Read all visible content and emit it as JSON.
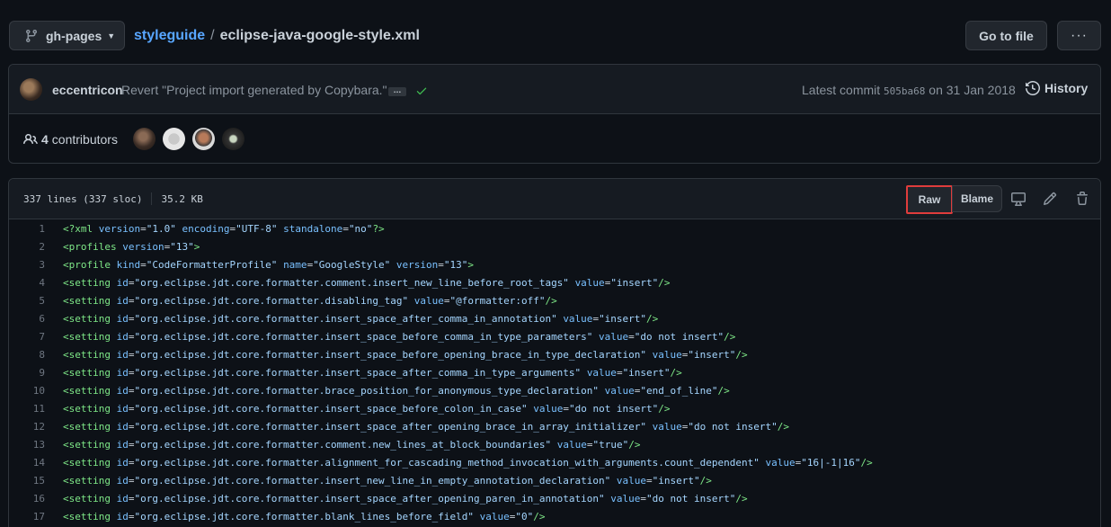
{
  "branch": {
    "label": "gh-pages"
  },
  "breadcrumb": {
    "repo": "styleguide",
    "separator": "/",
    "file": "eclipse-java-google-style.xml"
  },
  "header_buttons": {
    "go_to_file": "Go to file",
    "more": "···"
  },
  "commit": {
    "author": "eccentricon",
    "message": "Revert \"Project import generated by Copybara.\"",
    "ellipsis": "…",
    "latest_prefix": "Latest commit",
    "sha": "505ba68",
    "date_prefix": "on",
    "date": "31 Jan 2018",
    "history_label": "History",
    "status_color": "#3fb950"
  },
  "contributors": {
    "count": "4",
    "label": "contributors"
  },
  "file": {
    "lines_info": "337 lines (337 sloc)",
    "size": "35.2 KB",
    "raw_label": "Raw",
    "blame_label": "Blame"
  },
  "code_lines": [
    {
      "n": "1",
      "parts": [
        [
          "tag",
          "<?xml"
        ],
        [
          "punc",
          " "
        ],
        [
          "attr",
          "version"
        ],
        [
          "punc",
          "="
        ],
        [
          "str",
          "\"1.0\""
        ],
        [
          "punc",
          " "
        ],
        [
          "attr",
          "encoding"
        ],
        [
          "punc",
          "="
        ],
        [
          "str",
          "\"UTF-8\""
        ],
        [
          "punc",
          " "
        ],
        [
          "attr",
          "standalone"
        ],
        [
          "punc",
          "="
        ],
        [
          "str",
          "\"no\""
        ],
        [
          "tag",
          "?>"
        ]
      ]
    },
    {
      "n": "2",
      "parts": [
        [
          "tag",
          "<profiles"
        ],
        [
          "punc",
          " "
        ],
        [
          "attr",
          "version"
        ],
        [
          "punc",
          "="
        ],
        [
          "str",
          "\"13\""
        ],
        [
          "tag",
          ">"
        ]
      ]
    },
    {
      "n": "3",
      "parts": [
        [
          "tag",
          "<profile"
        ],
        [
          "punc",
          " "
        ],
        [
          "attr",
          "kind"
        ],
        [
          "punc",
          "="
        ],
        [
          "str",
          "\"CodeFormatterProfile\""
        ],
        [
          "punc",
          " "
        ],
        [
          "attr",
          "name"
        ],
        [
          "punc",
          "="
        ],
        [
          "str",
          "\"GoogleStyle\""
        ],
        [
          "punc",
          " "
        ],
        [
          "attr",
          "version"
        ],
        [
          "punc",
          "="
        ],
        [
          "str",
          "\"13\""
        ],
        [
          "tag",
          ">"
        ]
      ]
    },
    {
      "n": "4",
      "parts": [
        [
          "tag",
          "<setting"
        ],
        [
          "punc",
          " "
        ],
        [
          "attr",
          "id"
        ],
        [
          "punc",
          "="
        ],
        [
          "str",
          "\"org.eclipse.jdt.core.formatter.comment.insert_new_line_before_root_tags\""
        ],
        [
          "punc",
          " "
        ],
        [
          "attr",
          "value"
        ],
        [
          "punc",
          "="
        ],
        [
          "str",
          "\"insert\""
        ],
        [
          "tag",
          "/>"
        ]
      ]
    },
    {
      "n": "5",
      "parts": [
        [
          "tag",
          "<setting"
        ],
        [
          "punc",
          " "
        ],
        [
          "attr",
          "id"
        ],
        [
          "punc",
          "="
        ],
        [
          "str",
          "\"org.eclipse.jdt.core.formatter.disabling_tag\""
        ],
        [
          "punc",
          " "
        ],
        [
          "attr",
          "value"
        ],
        [
          "punc",
          "="
        ],
        [
          "str",
          "\"@formatter:off\""
        ],
        [
          "tag",
          "/>"
        ]
      ]
    },
    {
      "n": "6",
      "parts": [
        [
          "tag",
          "<setting"
        ],
        [
          "punc",
          " "
        ],
        [
          "attr",
          "id"
        ],
        [
          "punc",
          "="
        ],
        [
          "str",
          "\"org.eclipse.jdt.core.formatter.insert_space_after_comma_in_annotation\""
        ],
        [
          "punc",
          " "
        ],
        [
          "attr",
          "value"
        ],
        [
          "punc",
          "="
        ],
        [
          "str",
          "\"insert\""
        ],
        [
          "tag",
          "/>"
        ]
      ]
    },
    {
      "n": "7",
      "parts": [
        [
          "tag",
          "<setting"
        ],
        [
          "punc",
          " "
        ],
        [
          "attr",
          "id"
        ],
        [
          "punc",
          "="
        ],
        [
          "str",
          "\"org.eclipse.jdt.core.formatter.insert_space_before_comma_in_type_parameters\""
        ],
        [
          "punc",
          " "
        ],
        [
          "attr",
          "value"
        ],
        [
          "punc",
          "="
        ],
        [
          "str",
          "\"do not insert\""
        ],
        [
          "tag",
          "/>"
        ]
      ]
    },
    {
      "n": "8",
      "parts": [
        [
          "tag",
          "<setting"
        ],
        [
          "punc",
          " "
        ],
        [
          "attr",
          "id"
        ],
        [
          "punc",
          "="
        ],
        [
          "str",
          "\"org.eclipse.jdt.core.formatter.insert_space_before_opening_brace_in_type_declaration\""
        ],
        [
          "punc",
          " "
        ],
        [
          "attr",
          "value"
        ],
        [
          "punc",
          "="
        ],
        [
          "str",
          "\"insert\""
        ],
        [
          "tag",
          "/>"
        ]
      ]
    },
    {
      "n": "9",
      "parts": [
        [
          "tag",
          "<setting"
        ],
        [
          "punc",
          " "
        ],
        [
          "attr",
          "id"
        ],
        [
          "punc",
          "="
        ],
        [
          "str",
          "\"org.eclipse.jdt.core.formatter.insert_space_after_comma_in_type_arguments\""
        ],
        [
          "punc",
          " "
        ],
        [
          "attr",
          "value"
        ],
        [
          "punc",
          "="
        ],
        [
          "str",
          "\"insert\""
        ],
        [
          "tag",
          "/>"
        ]
      ]
    },
    {
      "n": "10",
      "parts": [
        [
          "tag",
          "<setting"
        ],
        [
          "punc",
          " "
        ],
        [
          "attr",
          "id"
        ],
        [
          "punc",
          "="
        ],
        [
          "str",
          "\"org.eclipse.jdt.core.formatter.brace_position_for_anonymous_type_declaration\""
        ],
        [
          "punc",
          " "
        ],
        [
          "attr",
          "value"
        ],
        [
          "punc",
          "="
        ],
        [
          "str",
          "\"end_of_line\""
        ],
        [
          "tag",
          "/>"
        ]
      ]
    },
    {
      "n": "11",
      "parts": [
        [
          "tag",
          "<setting"
        ],
        [
          "punc",
          " "
        ],
        [
          "attr",
          "id"
        ],
        [
          "punc",
          "="
        ],
        [
          "str",
          "\"org.eclipse.jdt.core.formatter.insert_space_before_colon_in_case\""
        ],
        [
          "punc",
          " "
        ],
        [
          "attr",
          "value"
        ],
        [
          "punc",
          "="
        ],
        [
          "str",
          "\"do not insert\""
        ],
        [
          "tag",
          "/>"
        ]
      ]
    },
    {
      "n": "12",
      "parts": [
        [
          "tag",
          "<setting"
        ],
        [
          "punc",
          " "
        ],
        [
          "attr",
          "id"
        ],
        [
          "punc",
          "="
        ],
        [
          "str",
          "\"org.eclipse.jdt.core.formatter.insert_space_after_opening_brace_in_array_initializer\""
        ],
        [
          "punc",
          " "
        ],
        [
          "attr",
          "value"
        ],
        [
          "punc",
          "="
        ],
        [
          "str",
          "\"do not insert\""
        ],
        [
          "tag",
          "/>"
        ]
      ]
    },
    {
      "n": "13",
      "parts": [
        [
          "tag",
          "<setting"
        ],
        [
          "punc",
          " "
        ],
        [
          "attr",
          "id"
        ],
        [
          "punc",
          "="
        ],
        [
          "str",
          "\"org.eclipse.jdt.core.formatter.comment.new_lines_at_block_boundaries\""
        ],
        [
          "punc",
          " "
        ],
        [
          "attr",
          "value"
        ],
        [
          "punc",
          "="
        ],
        [
          "str",
          "\"true\""
        ],
        [
          "tag",
          "/>"
        ]
      ]
    },
    {
      "n": "14",
      "parts": [
        [
          "tag",
          "<setting"
        ],
        [
          "punc",
          " "
        ],
        [
          "attr",
          "id"
        ],
        [
          "punc",
          "="
        ],
        [
          "str",
          "\"org.eclipse.jdt.core.formatter.alignment_for_cascading_method_invocation_with_arguments.count_dependent\""
        ],
        [
          "punc",
          " "
        ],
        [
          "attr",
          "value"
        ],
        [
          "punc",
          "="
        ],
        [
          "str",
          "\"16|-1|16\""
        ],
        [
          "tag",
          "/>"
        ]
      ]
    },
    {
      "n": "15",
      "parts": [
        [
          "tag",
          "<setting"
        ],
        [
          "punc",
          " "
        ],
        [
          "attr",
          "id"
        ],
        [
          "punc",
          "="
        ],
        [
          "str",
          "\"org.eclipse.jdt.core.formatter.insert_new_line_in_empty_annotation_declaration\""
        ],
        [
          "punc",
          " "
        ],
        [
          "attr",
          "value"
        ],
        [
          "punc",
          "="
        ],
        [
          "str",
          "\"insert\""
        ],
        [
          "tag",
          "/>"
        ]
      ]
    },
    {
      "n": "16",
      "parts": [
        [
          "tag",
          "<setting"
        ],
        [
          "punc",
          " "
        ],
        [
          "attr",
          "id"
        ],
        [
          "punc",
          "="
        ],
        [
          "str",
          "\"org.eclipse.jdt.core.formatter.insert_space_after_opening_paren_in_annotation\""
        ],
        [
          "punc",
          " "
        ],
        [
          "attr",
          "value"
        ],
        [
          "punc",
          "="
        ],
        [
          "str",
          "\"do not insert\""
        ],
        [
          "tag",
          "/>"
        ]
      ]
    },
    {
      "n": "17",
      "parts": [
        [
          "tag",
          "<setting"
        ],
        [
          "punc",
          " "
        ],
        [
          "attr",
          "id"
        ],
        [
          "punc",
          "="
        ],
        [
          "str",
          "\"org.eclipse.jdt.core.formatter.blank_lines_before_field\""
        ],
        [
          "punc",
          " "
        ],
        [
          "attr",
          "value"
        ],
        [
          "punc",
          "="
        ],
        [
          "str",
          "\"0\""
        ],
        [
          "tag",
          "/>"
        ]
      ]
    }
  ]
}
